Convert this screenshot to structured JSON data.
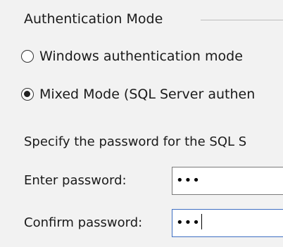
{
  "group": {
    "title": "Authentication Mode"
  },
  "radios": [
    {
      "label": "Windows authentication mode",
      "checked": false
    },
    {
      "label": "Mixed Mode (SQL Server authen",
      "checked": true
    }
  ],
  "instruction": "Specify the password for the SQL S",
  "fields": {
    "enter": {
      "label": "Enter password:",
      "value": "•••"
    },
    "confirm": {
      "label": "Confirm password:",
      "value": "•••"
    }
  }
}
